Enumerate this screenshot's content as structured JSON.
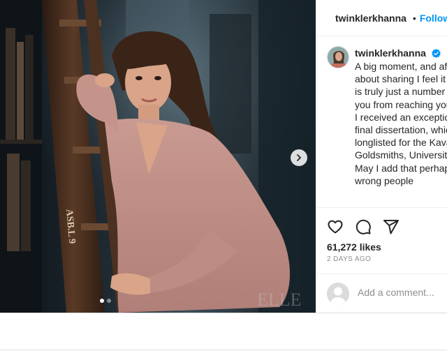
{
  "post": {
    "username": "twinklerkhanna",
    "follow_label": "Follow",
    "separator": "•",
    "time_ago": "2d",
    "caption": "A big moment, and after being hesitant about sharing I feel it may show that age is truly just a number and doesn't hinder you from reaching your goals.\nI received an exceptional grade for my final dissertation, which has also been longlisted for the Kavanagh Prize by Goldsmiths, University of London.\nMay I add that perhaps they cast the wrong people",
    "likes": "61,272 likes",
    "posted_ago": "2 DAYS AGO",
    "comment_placeholder": "Add a comment..."
  },
  "media": {
    "carousel_slides": 2,
    "current_slide": 1,
    "book_spine_text": "ASB.L 9"
  },
  "icons": {
    "verified": "verified-badge-icon",
    "next": "chevron-right-icon",
    "like": "heart-icon",
    "comment": "comment-icon",
    "share": "share-icon"
  },
  "colors": {
    "accent": "#0095f6",
    "text": "#262626",
    "muted": "#8e8e8e",
    "border": "#efefef"
  }
}
